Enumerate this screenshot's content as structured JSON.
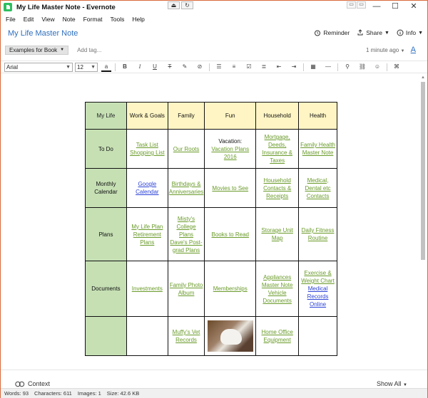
{
  "window": {
    "title": "My Life Master Note - Evernote"
  },
  "titlebar": {
    "center_btn1": "⏏",
    "center_btn2": "↻",
    "mini_btn1": "▭",
    "mini_btn2": "▭",
    "minimize": "—",
    "maximize": "☐",
    "close": "✕"
  },
  "menu": [
    "File",
    "Edit",
    "View",
    "Note",
    "Format",
    "Tools",
    "Help"
  ],
  "note": {
    "title": "My Life Master Note",
    "reminder": "Reminder",
    "share": "Share",
    "info": "Info",
    "notebook": "Examples for Book",
    "add_tag": "Add tag...",
    "updated": "1 minute ago"
  },
  "toolbar": {
    "font": "Arial",
    "size": "12"
  },
  "grid": {
    "corner": "My Life",
    "headers": [
      "Work & Goals",
      "Family",
      "Fun",
      "Household",
      "Health"
    ],
    "rows": [
      {
        "label": "To Do",
        "cells": [
          [
            {
              "t": "Task List",
              "c": "lk"
            },
            {
              "t": "Shopping List",
              "c": "lk"
            }
          ],
          [
            {
              "t": "Our Roots",
              "c": "lk"
            }
          ],
          [
            {
              "t": "Vacation:",
              "c": "txt"
            },
            {
              "t": "Vacation Plans 2016",
              "c": "lk"
            }
          ],
          [
            {
              "t": "Mortgage, Deeds, Insurance & Taxes",
              "c": "lk"
            }
          ],
          [
            {
              "t": "Family Health Master Note",
              "c": "lk"
            }
          ]
        ]
      },
      {
        "label": "Monthly Calendar",
        "cells": [
          [
            {
              "t": "Google Calendar",
              "c": "lkb"
            }
          ],
          [
            {
              "t": "Birthdays & Anniversaries",
              "c": "lk"
            }
          ],
          [
            {
              "t": "Movies to See",
              "c": "lk"
            }
          ],
          [
            {
              "t": "Household Contacts & Receipts",
              "c": "lk"
            }
          ],
          [
            {
              "t": "Medical, Dental etc Contacts",
              "c": "lk"
            }
          ]
        ]
      },
      {
        "label": "Plans",
        "cells": [
          [
            {
              "t": "My Life Plan",
              "c": "lk"
            },
            {
              "t": "Retirement Plans",
              "c": "lk"
            }
          ],
          [
            {
              "t": "Misty's College Plans",
              "c": "lk"
            },
            {
              "t": "Dave's Post-grad Plans",
              "c": "lk"
            }
          ],
          [
            {
              "t": "Books to Read",
              "c": "lk"
            }
          ],
          [
            {
              "t": "Storage Unit Map",
              "c": "lk"
            }
          ],
          [
            {
              "t": "Daily Fitness Routine",
              "c": "lk"
            }
          ]
        ]
      },
      {
        "label": "Documents",
        "cells": [
          [
            {
              "t": "Investments",
              "c": "lk"
            }
          ],
          [
            {
              "t": "Family Photo Album",
              "c": "lk"
            }
          ],
          [
            {
              "t": "Memberships",
              "c": "lk"
            }
          ],
          [
            {
              "t": "Appliances Master Note",
              "c": "lk"
            },
            {
              "t": "Vehicle Documents",
              "c": "lk"
            }
          ],
          [
            {
              "t": "Exercise & Weight Chart",
              "c": "lk"
            },
            {
              "t": "Medical Records Online",
              "c": "lkb"
            }
          ]
        ]
      },
      {
        "label": "",
        "cells": [
          [],
          [
            {
              "t": "Muffy's Vet Records",
              "c": "lk"
            }
          ],
          [
            {
              "img": "dog-photo"
            }
          ],
          [
            {
              "t": "Home Office Equipment",
              "c": "lk"
            }
          ],
          []
        ]
      }
    ]
  },
  "context": {
    "label": "Context",
    "show_all": "Show All"
  },
  "status": {
    "words": "Words: 93",
    "characters": "Characters: 611",
    "images": "Images: 1",
    "size": "Size: 42.6 KB"
  }
}
